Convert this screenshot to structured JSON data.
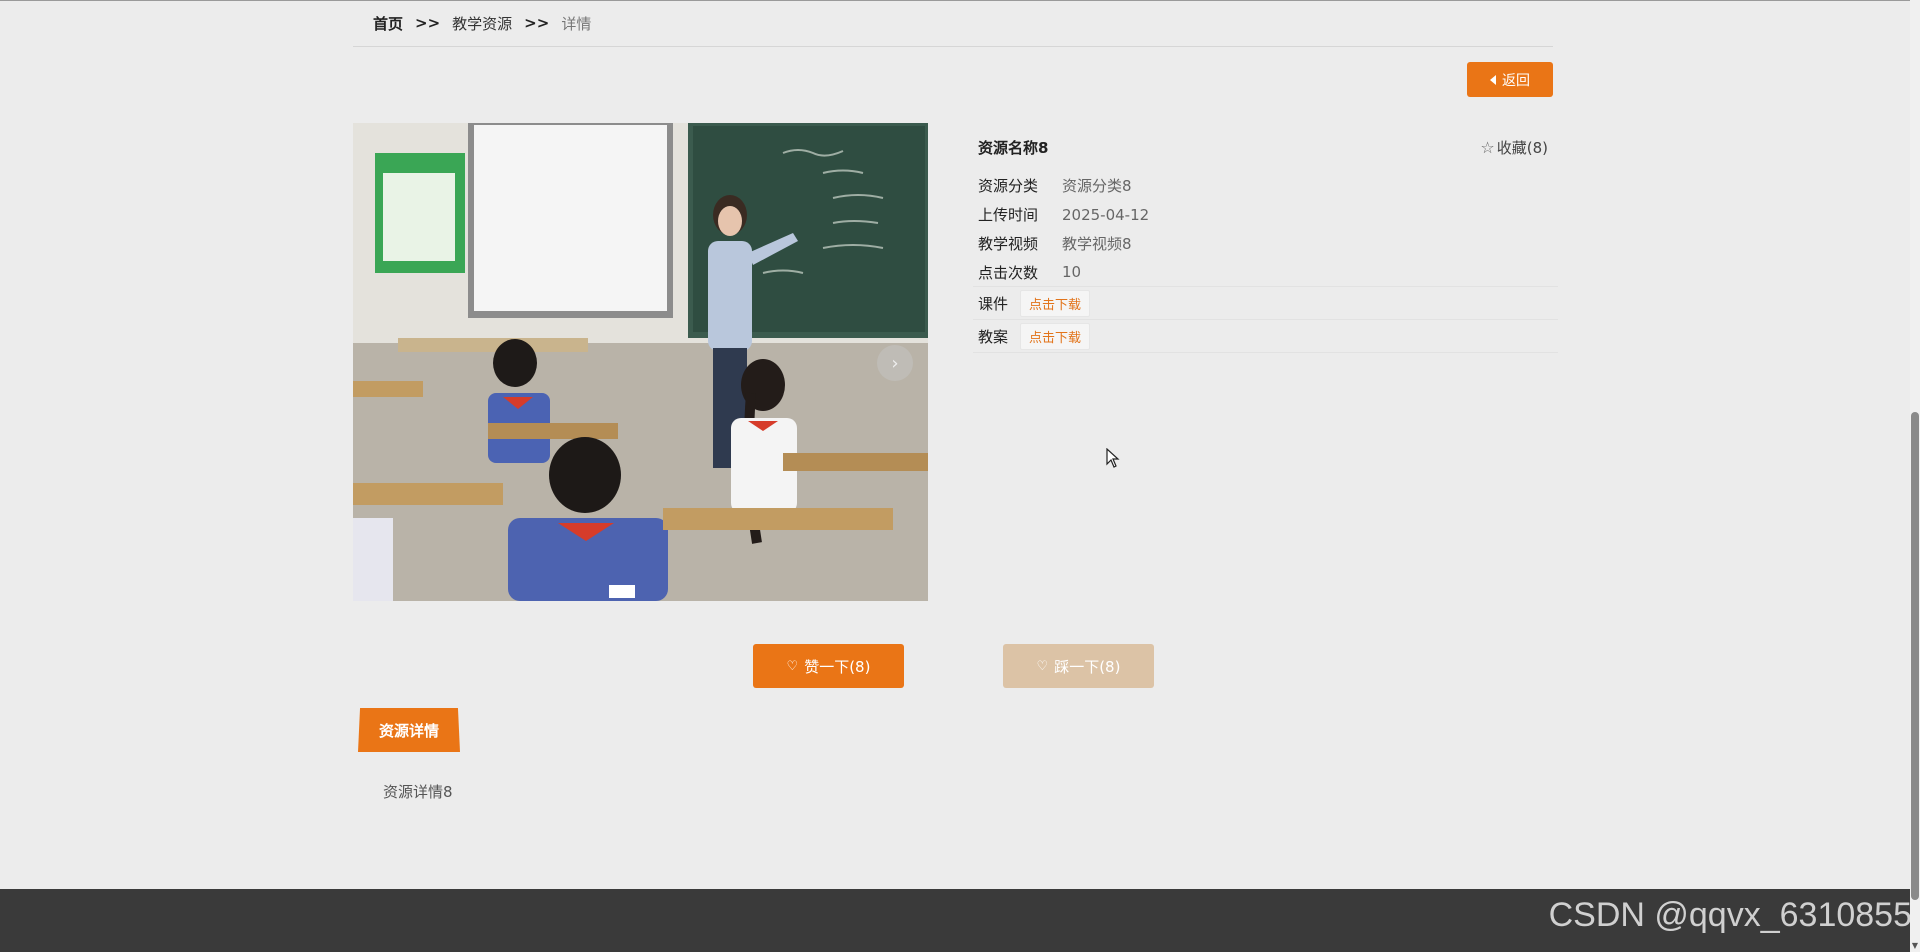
{
  "breadcrumb": {
    "home": "首页",
    "separator": ">>",
    "section": "教学资源",
    "current": "详情"
  },
  "back_button": {
    "label": "返回"
  },
  "resource": {
    "name": "资源名称8",
    "favorite_label": "收藏(8)",
    "fields": [
      {
        "label": "资源分类",
        "value": "资源分类8"
      },
      {
        "label": "上传时间",
        "value": "2025-04-12"
      },
      {
        "label": "教学视频",
        "value": "教学视频8"
      },
      {
        "label": "点击次数",
        "value": "10"
      }
    ],
    "downloads": [
      {
        "label": "课件",
        "button": "点击下载"
      },
      {
        "label": "教案",
        "button": "点击下载"
      }
    ]
  },
  "carousel": {
    "next_glyph": "›"
  },
  "votes": {
    "like_label": "赞一下(8)",
    "dislike_label": "踩一下(8)"
  },
  "detail": {
    "tab_label": "资源详情",
    "content": "资源详情8"
  },
  "watermark": "CSDN @qqvx_6310855",
  "colors": {
    "accent": "#ea7516",
    "accent_muted": "#dcc3a6",
    "footer": "#3a3a3a",
    "background": "#ececec"
  }
}
